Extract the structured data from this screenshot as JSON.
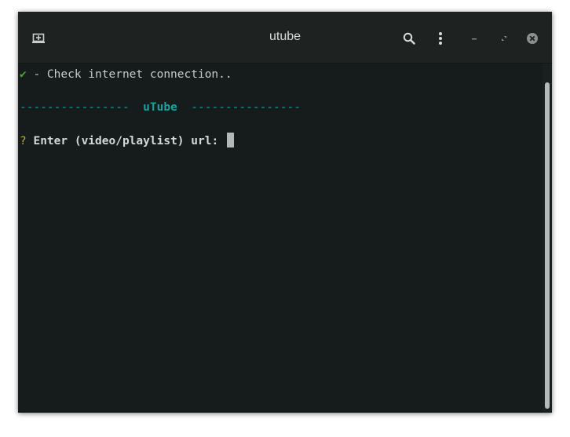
{
  "window": {
    "title": "utube"
  },
  "titlebar": {
    "icons": [
      "new-tab-icon",
      "search-icon",
      "menu-icon",
      "minimize-icon",
      "maximize-icon",
      "close-icon"
    ]
  },
  "terminal": {
    "line1": {
      "check": "✔",
      "text": " - Check internet connection.."
    },
    "line2": {
      "dashes_left": "----------------",
      "app_name": "uTube",
      "dashes_right": "----------------"
    },
    "line3": {
      "prompt_mark": "?",
      "prompt_text": "Enter (video/playlist) url:"
    }
  },
  "colors": {
    "background": "#161b1b",
    "titlebar": "#1e2322",
    "success": "#4ea72a",
    "accent": "#19a2a2",
    "prompt": "#b8b03a",
    "text": "#c8cccb"
  }
}
